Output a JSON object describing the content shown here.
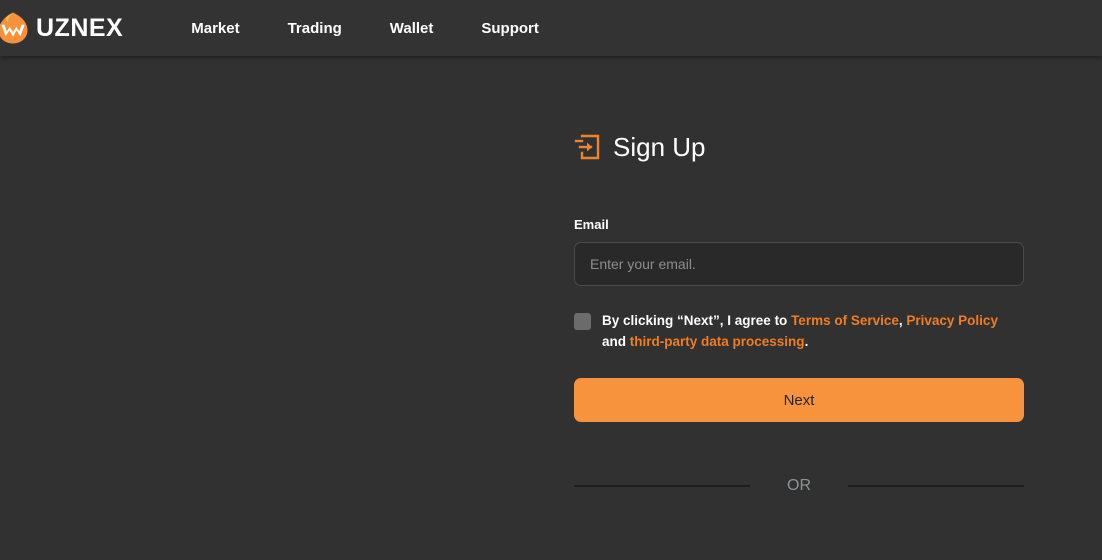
{
  "header": {
    "brand": {
      "name": "UZNEX",
      "mark_icon": "uznex-flame-logo-icon",
      "color": "#f6913c"
    },
    "nav": [
      {
        "label": "Market"
      },
      {
        "label": "Trading"
      },
      {
        "label": "Wallet"
      },
      {
        "label": "Support"
      }
    ]
  },
  "signup": {
    "icon": "sign-in-arrow-icon",
    "title": "Sign Up",
    "email": {
      "label": "Email",
      "placeholder": "Enter your email.",
      "value": ""
    },
    "terms": {
      "checked": false,
      "prefix": "By clicking “Next”, I agree to ",
      "link_terms": "Terms of Service",
      "separator_1": ", ",
      "link_privacy": "Privacy Policy",
      "separator_2": " and ",
      "link_third_party": "third-party data processing",
      "suffix": "."
    },
    "next_label": "Next",
    "or_label": "OR"
  },
  "colors": {
    "accent": "#f7933d",
    "link": "#f07d22",
    "page_bg": "#313131",
    "header_bg": "#333333",
    "input_bg": "#292929"
  }
}
